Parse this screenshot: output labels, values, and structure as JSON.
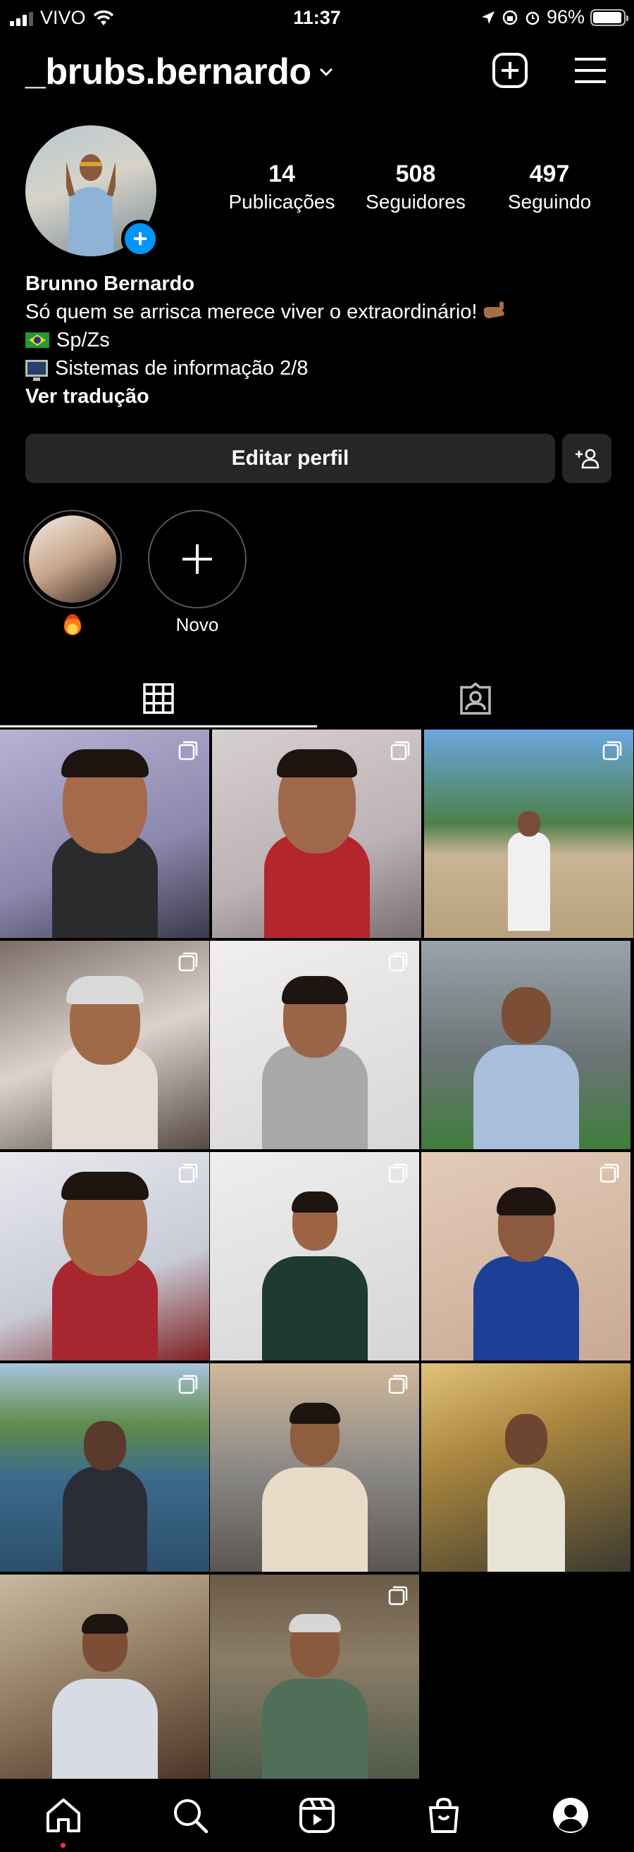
{
  "status_bar": {
    "carrier": "VIVO",
    "time": "11:37",
    "battery": "96%",
    "battery_level": 0.96
  },
  "header": {
    "username": "_brubs.bernardo"
  },
  "profile": {
    "stats": [
      {
        "value": "14",
        "label": "Publicações"
      },
      {
        "value": "508",
        "label": "Seguidores"
      },
      {
        "value": "497",
        "label": "Seguindo"
      }
    ],
    "name": "Brunno Bernardo",
    "bio_line1": "Só quem se arrisca merece viver o extraordinário!",
    "bio_line2": "Sp/Zs",
    "bio_line3": "Sistemas de informação 2/8",
    "translate": "Ver tradução"
  },
  "actions": {
    "edit_profile": "Editar perfil"
  },
  "highlights": [
    {
      "label": ""
    },
    {
      "label": "Novo"
    }
  ],
  "colors": {
    "accent_blue": "#0095f6",
    "button_gray": "#262626",
    "notification_red": "#ff3040"
  },
  "icons": [
    "wifi-icon",
    "location-arrow-icon",
    "alarm-icon",
    "lock-rotation-icon",
    "battery-icon",
    "chevron-down-icon",
    "new-post-icon",
    "menu-icon",
    "add-person-icon",
    "plus-icon",
    "grid-icon",
    "tagged-icon",
    "multiple-posts-icon",
    "home-icon",
    "search-icon",
    "reels-icon",
    "shop-icon",
    "profile-icon"
  ]
}
